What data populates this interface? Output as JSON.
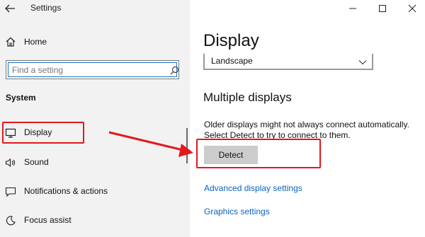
{
  "window": {
    "title": "Settings"
  },
  "window_controls": {
    "minimize": "minimize-icon",
    "maximize": "maximize-icon",
    "close": "close-icon"
  },
  "sidebar": {
    "home_label": "Home",
    "search_placeholder": "Find a setting",
    "section_label": "System",
    "items": [
      {
        "label": "Display",
        "icon": "monitor-icon"
      },
      {
        "label": "Sound",
        "icon": "speaker-icon"
      },
      {
        "label": "Notifications & actions",
        "icon": "notification-icon"
      },
      {
        "label": "Focus assist",
        "icon": "moon-icon"
      }
    ]
  },
  "main": {
    "title": "Display",
    "orientation_value": "Landscape",
    "multiple_displays": {
      "heading": "Multiple displays",
      "description": "Older displays might not always connect automatically. Select Detect to try to connect to them.",
      "detect_label": "Detect"
    },
    "links": {
      "advanced": "Advanced display settings",
      "graphics": "Graphics settings"
    }
  },
  "annotation": {
    "color": "#e3181c"
  }
}
